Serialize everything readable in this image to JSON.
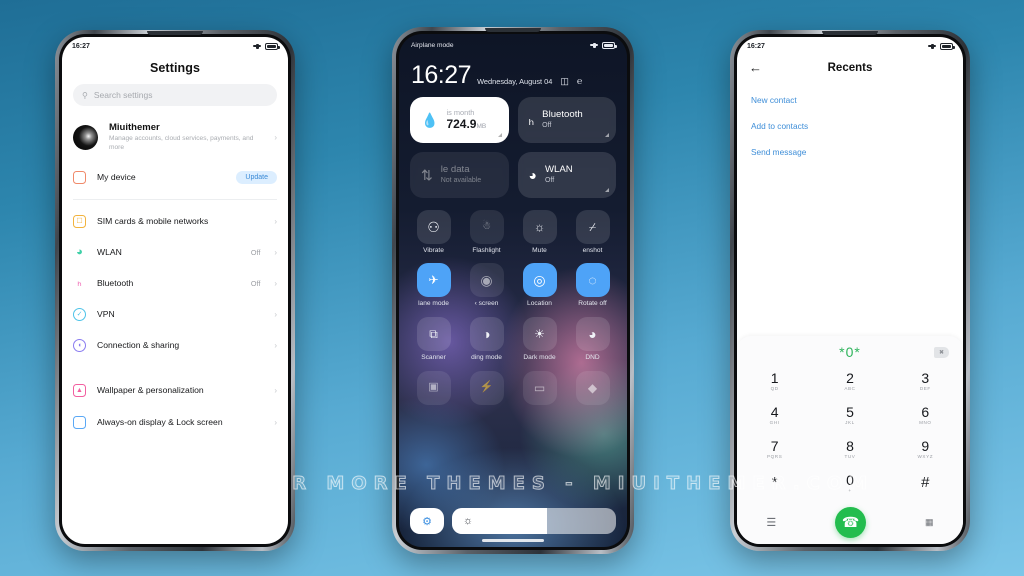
{
  "watermark": "VISIT FOR MORE THEMES - MIUITHEMER.COM",
  "background": {
    "top_color": "#1f6e96",
    "bottom_color": "#7cc6e8"
  },
  "phone_settings": {
    "statusbar": {
      "time": "16:27",
      "signal_icon": "signal-icon",
      "battery_icon": "battery-icon"
    },
    "title": "Settings",
    "search": {
      "placeholder": "Search settings",
      "icon": "search-icon"
    },
    "account": {
      "name": "Miuithemer",
      "subtitle": "Manage accounts, cloud services, payments, and more",
      "chevron": "›"
    },
    "device_row": {
      "label": "My device",
      "badge": "Update",
      "icon": "phone-outline-icon",
      "color": "#f08a6a"
    },
    "items": [
      {
        "label": "SIM cards & mobile networks",
        "value": "",
        "icon": "sim-card-icon",
        "color": "#f2b33d",
        "chevron": "›"
      },
      {
        "label": "WLAN",
        "value": "Off",
        "icon": "wifi-icon",
        "color": "#3fd0a8",
        "chevron": "›"
      },
      {
        "label": "Bluetooth",
        "value": "Off",
        "icon": "bluetooth-icon",
        "color": "#ef5fb0",
        "chevron": "›"
      },
      {
        "label": "VPN",
        "value": "",
        "icon": "vpn-shield-icon",
        "color": "#4ec3e8",
        "chevron": "›"
      },
      {
        "label": "Connection & sharing",
        "value": "",
        "icon": "connection-sharing-icon",
        "color": "#8a7cf0",
        "chevron": "›"
      },
      {
        "label": "Wallpaper & personalization",
        "value": "",
        "icon": "wallpaper-icon",
        "color": "#f25fa0",
        "chevron": "›"
      },
      {
        "label": "Always-on display & Lock screen",
        "value": "",
        "icon": "lockscreen-icon",
        "color": "#5aa8f5",
        "chevron": "›"
      }
    ]
  },
  "phone_control_center": {
    "statusbar": {
      "label": "Airplane mode",
      "signal_icon": "signal-icon",
      "battery_icon": "battery-icon"
    },
    "clock": {
      "time": "16:27",
      "date": "Wednesday, August 04"
    },
    "header_icons": [
      "edit-toggles-icon",
      "settings-shortcut-icon"
    ],
    "big_tiles": [
      {
        "name": "data-usage-tile",
        "icon": "water-drop-icon",
        "line1": "is month",
        "value": "724.9",
        "unit": "MB",
        "state": "light"
      },
      {
        "name": "bluetooth-tile",
        "icon": "bluetooth-icon",
        "title": "Bluetooth",
        "state_label": "Off",
        "state": "normal"
      },
      {
        "name": "mobile-data-tile",
        "icon": "data-arrows-icon",
        "title": "le data",
        "state_label": "Not available",
        "state": "dim"
      },
      {
        "name": "wlan-tile",
        "icon": "wifi-icon",
        "title": "WLAN",
        "state_label": "Off",
        "state": "normal"
      }
    ],
    "toggles": [
      {
        "label": "Vibrate",
        "icon": "vibrate-icon",
        "glyph": "○",
        "state": "off"
      },
      {
        "label": "Flashlight",
        "icon": "flashlight-icon",
        "glyph": "ὒ6",
        "state": "off"
      },
      {
        "label": "Mute",
        "icon": "mute-bell-icon",
        "glyph": "ὑ4",
        "state": "off"
      },
      {
        "label": "enshot",
        "icon": "screenshot-icon",
        "glyph": "⛶",
        "state": "off"
      },
      {
        "label": "lane mode",
        "icon": "airplane-icon",
        "glyph": "✈",
        "state": "on"
      },
      {
        "label": "‹ screen",
        "icon": "cast-screen-icon",
        "glyph": "◉",
        "state": "faint"
      },
      {
        "label": "Location",
        "icon": "location-pin-icon",
        "glyph": "◎",
        "state": "on"
      },
      {
        "label": "Rotate off",
        "icon": "rotate-lock-icon",
        "glyph": "◔",
        "state": "on"
      },
      {
        "label": "Scanner",
        "icon": "qr-scanner-icon",
        "glyph": "⧉",
        "state": "off"
      },
      {
        "label": "ding mode",
        "icon": "reading-mode-icon",
        "glyph": "◑",
        "state": "off"
      },
      {
        "label": "Dark mode",
        "icon": "dark-mode-sun-icon",
        "glyph": "☀",
        "state": "off"
      },
      {
        "label": "DND",
        "icon": "dnd-moon-icon",
        "glyph": "◕",
        "state": "off"
      },
      {
        "label": "",
        "icon": "battery-saver-icon",
        "glyph": "□",
        "state": "off"
      },
      {
        "label": "",
        "icon": "ultra-battery-icon",
        "glyph": "⚡",
        "state": "off"
      },
      {
        "label": "",
        "icon": "cast-device-icon",
        "glyph": "▭",
        "state": "off"
      },
      {
        "label": "",
        "icon": "contrast-icon",
        "glyph": "◆",
        "state": "off"
      }
    ],
    "bottom_bar": {
      "settings_icon": "settings-gear-icon",
      "brightness_icon": "brightness-icon",
      "brightness_percent": 58
    }
  },
  "phone_dialer": {
    "statusbar": {
      "time": "16:27",
      "signal_icon": "signal-icon",
      "battery_icon": "battery-icon"
    },
    "back_icon": "back-arrow-icon",
    "title": "Recents",
    "actions": [
      "New contact",
      "Add to contacts",
      "Send message"
    ],
    "dialed_number": "*0*",
    "number_color": "#2fb45c",
    "delete_icon": "backspace-icon",
    "keys": [
      {
        "digit": "1",
        "letters": "QD"
      },
      {
        "digit": "2",
        "letters": "ABC"
      },
      {
        "digit": "3",
        "letters": "DEF"
      },
      {
        "digit": "4",
        "letters": "GHI"
      },
      {
        "digit": "5",
        "letters": "JKL"
      },
      {
        "digit": "6",
        "letters": "MNO"
      },
      {
        "digit": "7",
        "letters": "PQRS"
      },
      {
        "digit": "8",
        "letters": "TUV"
      },
      {
        "digit": "9",
        "letters": "WXYZ"
      },
      {
        "digit": "*",
        "letters": ""
      },
      {
        "digit": "0",
        "letters": "+"
      },
      {
        "digit": "#",
        "letters": ""
      }
    ],
    "footer": {
      "menu_icon": "menu-lines-icon",
      "call_icon": "call-handset-icon",
      "keypad_icon": "keypad-grid-icon",
      "call_button_color": "#23bd4e"
    }
  }
}
